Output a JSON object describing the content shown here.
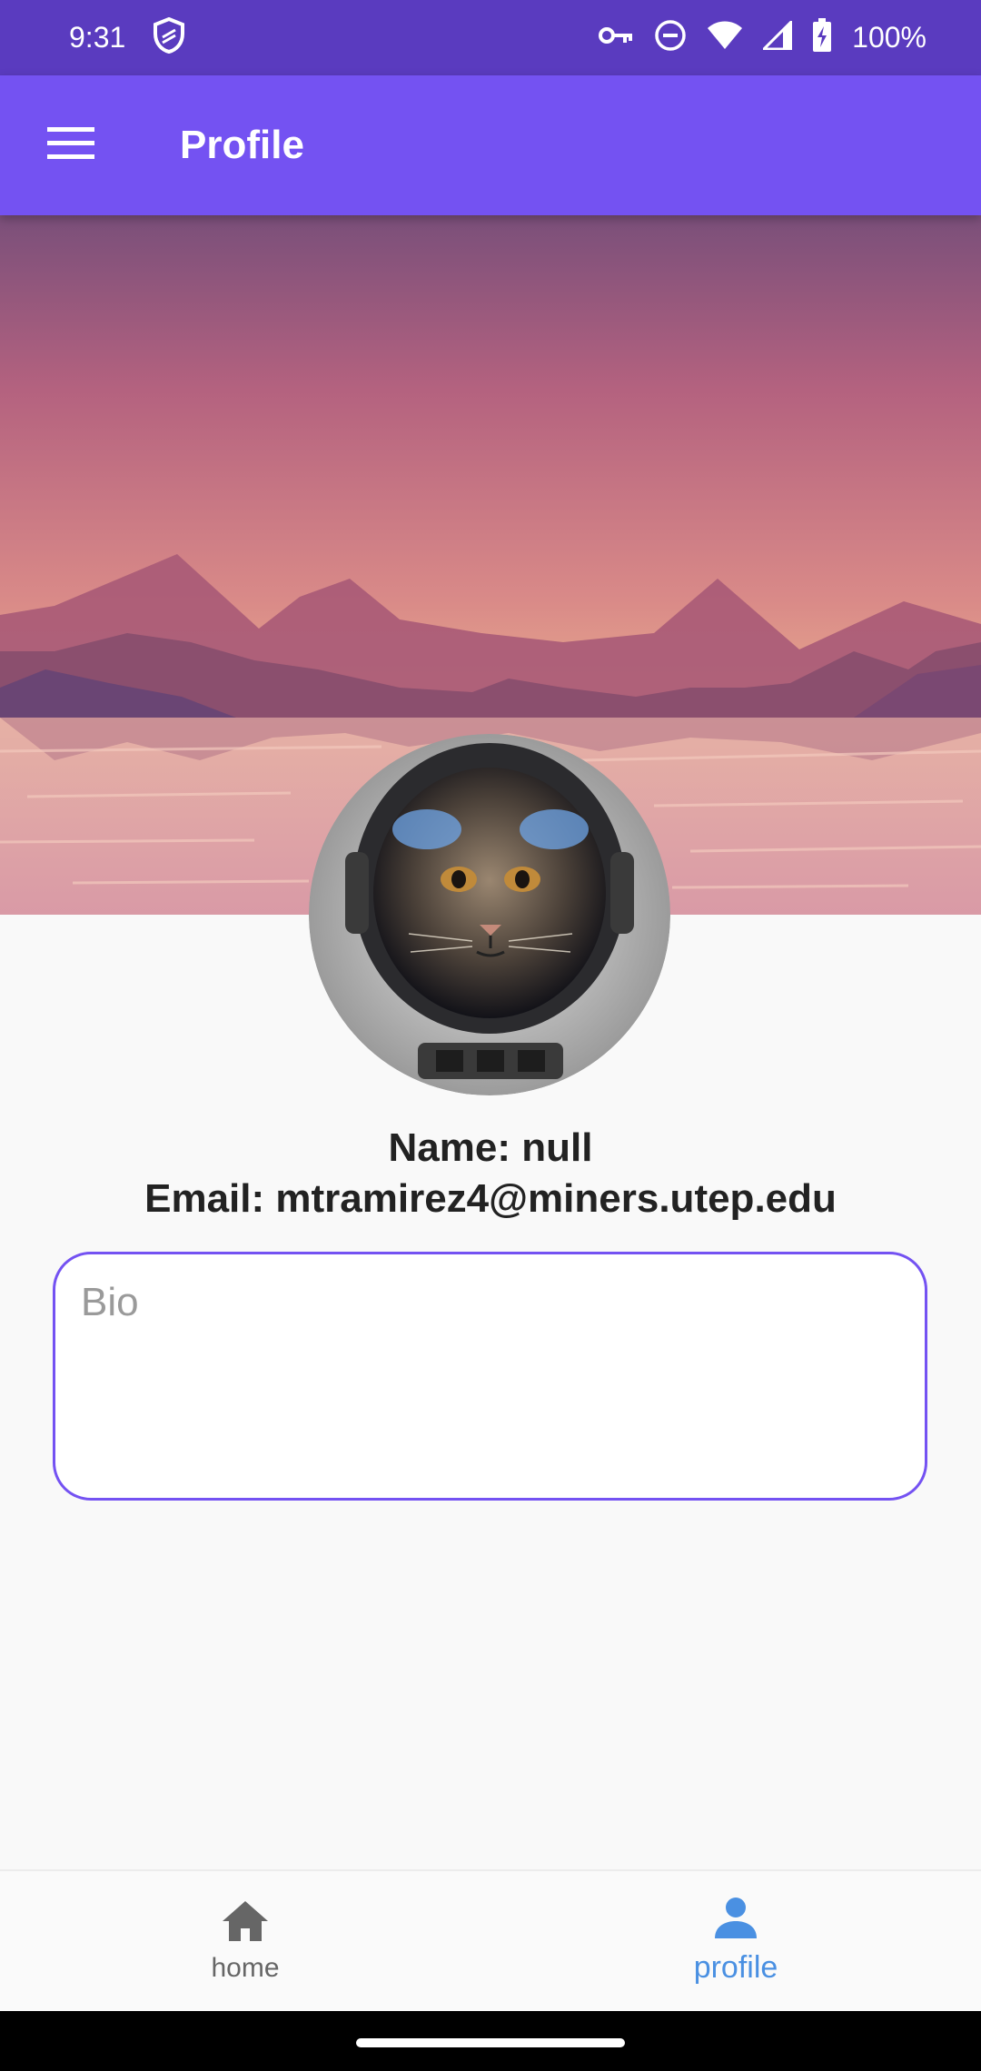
{
  "status_bar": {
    "time": "9:31",
    "battery_text": "100%",
    "icons": [
      "shield-icon",
      "vpn-key-icon",
      "do-not-disturb-icon",
      "wifi-icon",
      "signal-icon",
      "battery-charging-icon"
    ]
  },
  "app_bar": {
    "title": "Profile",
    "menu_icon": "menu-icon"
  },
  "profile": {
    "name_line": "Name: null",
    "email_line": "Email: mtramirez4@miners.utep.edu",
    "avatar": "astronaut-cat-avatar"
  },
  "bio": {
    "placeholder": "Bio",
    "value": ""
  },
  "bottom_nav": {
    "items": [
      {
        "label": "home",
        "icon": "home-icon",
        "active": false
      },
      {
        "label": "profile",
        "icon": "person-icon",
        "active": true
      }
    ]
  },
  "colors": {
    "status_bar": "#5a3bbf",
    "app_bar": "#7452f2",
    "active_nav": "#4a90e2",
    "inactive_nav": "#666666"
  }
}
